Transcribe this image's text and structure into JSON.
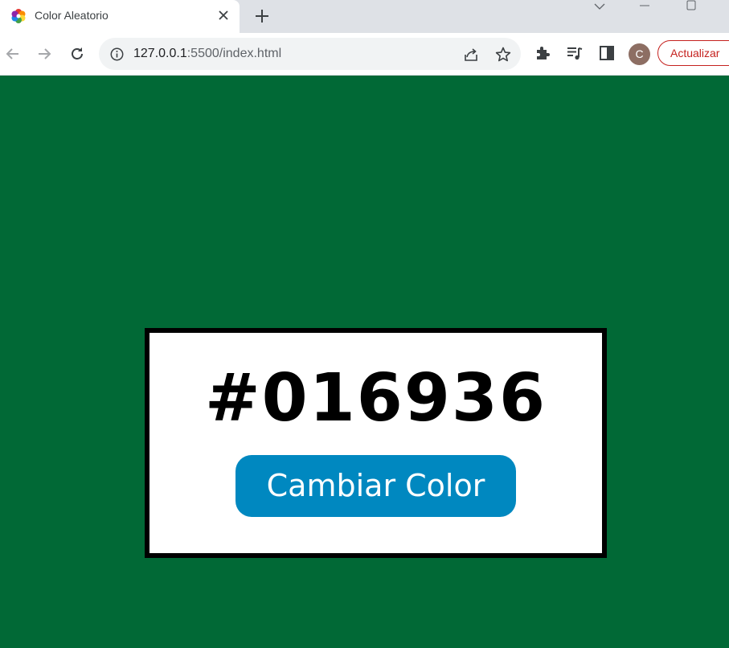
{
  "tab": {
    "title": "Color Aleatorio",
    "close_icon": "close-icon",
    "favicon": "color-wheel-icon"
  },
  "toolbar": {
    "url_host": "127.0.0.1",
    "url_rest": ":5500/index.html",
    "profile_initial": "C",
    "update_label": "Actualizar"
  },
  "page": {
    "background_color": "#016936",
    "color_code": "#016936",
    "button_label": "Cambiar Color",
    "button_color": "#0088c0",
    "card_border_color": "#000000"
  }
}
